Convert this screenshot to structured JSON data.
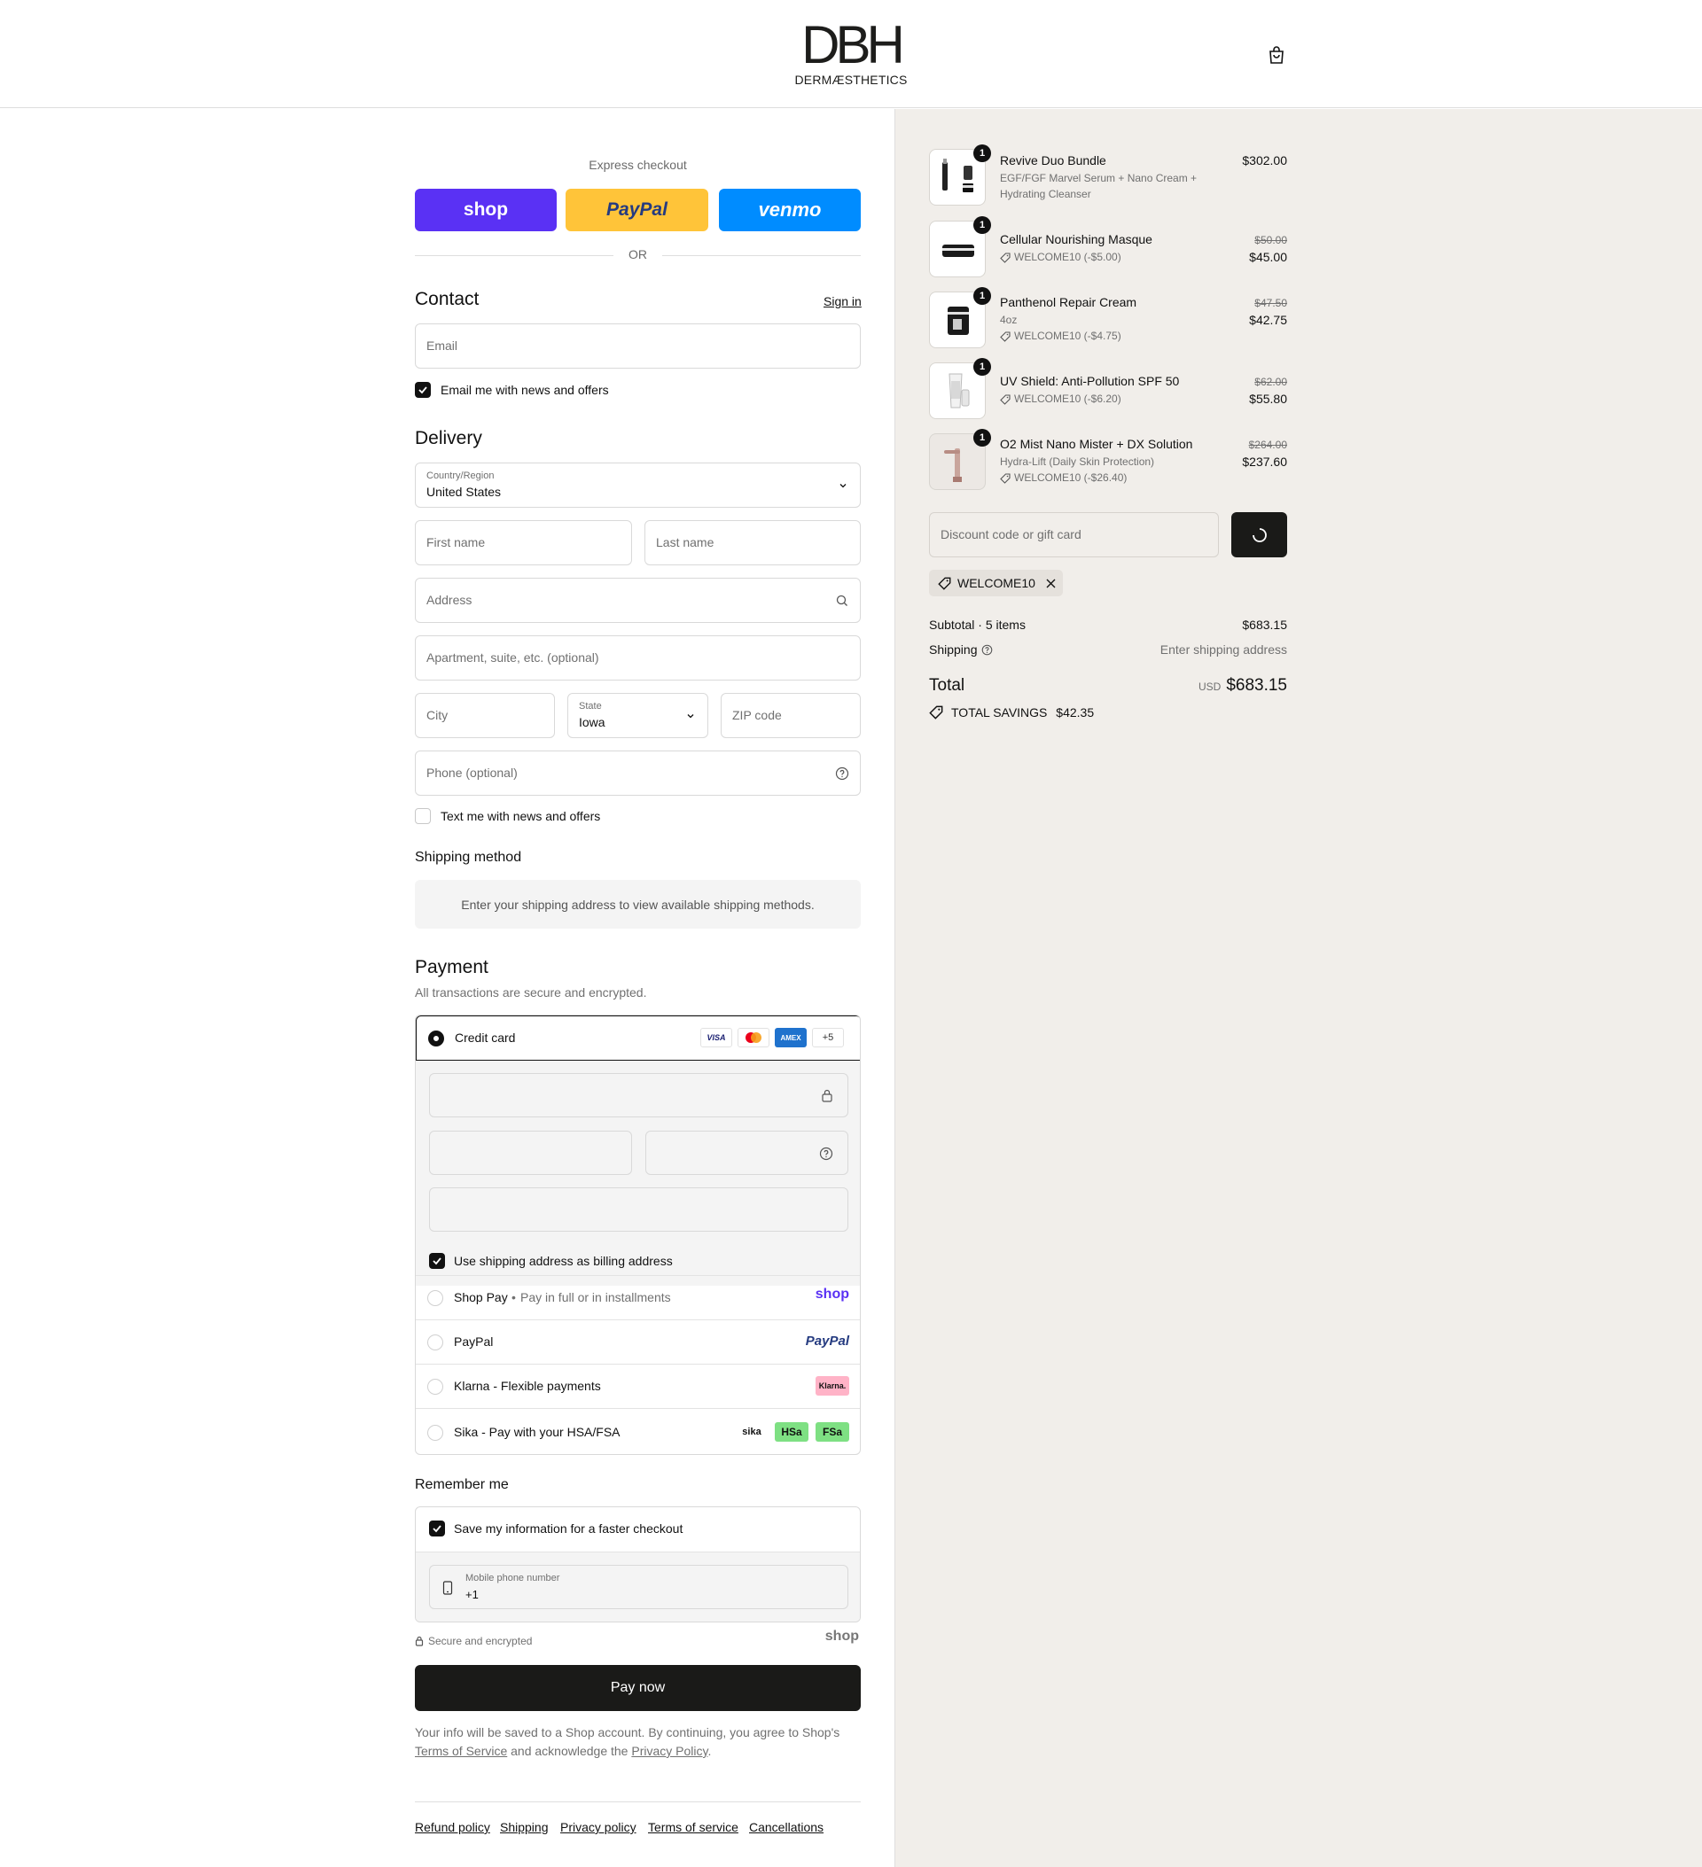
{
  "brand": {
    "logo": "DBH",
    "logo_sub": "DERMÆSTHETICS"
  },
  "express": {
    "title": "Express checkout",
    "shop_label": "shop",
    "paypal_label": "PayPal",
    "venmo_label": "venmo",
    "or_label": "OR"
  },
  "contact": {
    "title": "Contact",
    "sign_in": "Sign in",
    "email_placeholder": "Email",
    "email_news_label": "Email me with news and offers"
  },
  "delivery": {
    "title": "Delivery",
    "country_label": "Country/Region",
    "country_value": "United States",
    "first_name_placeholder": "First name",
    "last_name_placeholder": "Last name",
    "address_placeholder": "Address",
    "apartment_placeholder": "Apartment, suite, etc. (optional)",
    "city_placeholder": "City",
    "state_label": "State",
    "state_value": "Iowa",
    "zip_placeholder": "ZIP code",
    "phone_placeholder": "Phone (optional)",
    "text_news_label": "Text me with news and offers"
  },
  "shipping_method": {
    "title": "Shipping method",
    "message": "Enter your shipping address to view available shipping methods."
  },
  "payment": {
    "title": "Payment",
    "subtitle": "All transactions are secure and encrypted.",
    "credit_card_label": "Credit card",
    "card_badges": [
      "VISA",
      "AMEX",
      "+5"
    ],
    "billing_same_label": "Use shipping address as billing address",
    "shop_pay_label": "Shop Pay",
    "shop_pay_sub": "Pay in full or in installments",
    "shop_pay_logo": "shop",
    "paypal_label": "PayPal",
    "paypal_logo": "PayPal",
    "klarna_label": "Klarna - Flexible payments",
    "klarna_logo": "Klarna.",
    "sika_label": "Sika - Pay with your HSA/FSA",
    "sika_logos": [
      "sika",
      "HSa",
      "FSa"
    ]
  },
  "remember": {
    "title": "Remember me",
    "save_label": "Save my information for a faster checkout",
    "mobile_label": "Mobile phone number",
    "mobile_value": "+1",
    "secure_label": "Secure and encrypted",
    "shop_logo": "shop"
  },
  "pay_now": "Pay now",
  "legal": {
    "text_1": "Your info will be saved to a Shop account. By continuing, you agree to Shop's",
    "terms_link": "Terms of Service",
    "text_2": "and acknowledge the",
    "privacy_link": "Privacy Policy",
    "text_3": "."
  },
  "footer": {
    "links": [
      "Refund policy",
      "Shipping",
      "Privacy policy",
      "Terms of service",
      "Cancellations"
    ]
  },
  "cart": {
    "items": [
      {
        "qty": "1",
        "name": "Revive Duo Bundle",
        "sub": "EGF/FGF Marvel Serum + Nano Cream + Hydrating Cleanser",
        "price": "$302.00"
      },
      {
        "qty": "1",
        "name": "Cellular Nourishing Masque",
        "discount": "WELCOME10 (-$5.00)",
        "old_price": "$50.00",
        "price": "$45.00"
      },
      {
        "qty": "1",
        "name": "Panthenol Repair Cream",
        "sub": "4oz",
        "discount": "WELCOME10 (-$4.75)",
        "old_price": "$47.50",
        "price": "$42.75"
      },
      {
        "qty": "1",
        "name": "UV Shield: Anti-Pollution SPF 50",
        "discount": "WELCOME10 (-$6.20)",
        "old_price": "$62.00",
        "price": "$55.80"
      },
      {
        "qty": "1",
        "name": "O2 Mist Nano Mister + DX Solution",
        "sub": "Hydra-Lift (Daily Skin Protection)",
        "discount": "WELCOME10 (-$26.40)",
        "old_price": "$264.00",
        "price": "$237.60"
      }
    ],
    "discount_placeholder": "Discount code or gift card",
    "applied_code": "WELCOME10",
    "subtotal_label": "Subtotal · 5 items",
    "subtotal_value": "$683.15",
    "shipping_label": "Shipping",
    "shipping_value": "Enter shipping address",
    "total_label": "Total",
    "currency": "USD",
    "total_value": "$683.15",
    "savings_label": "TOTAL SAVINGS",
    "savings_value": "$42.35"
  },
  "colors": {
    "shop_purple": "#5a31f4",
    "paypal_yellow": "#ffc439",
    "venmo_blue": "#008cff",
    "dark": "#1a1a18",
    "summary_bg": "#f1eeea"
  }
}
